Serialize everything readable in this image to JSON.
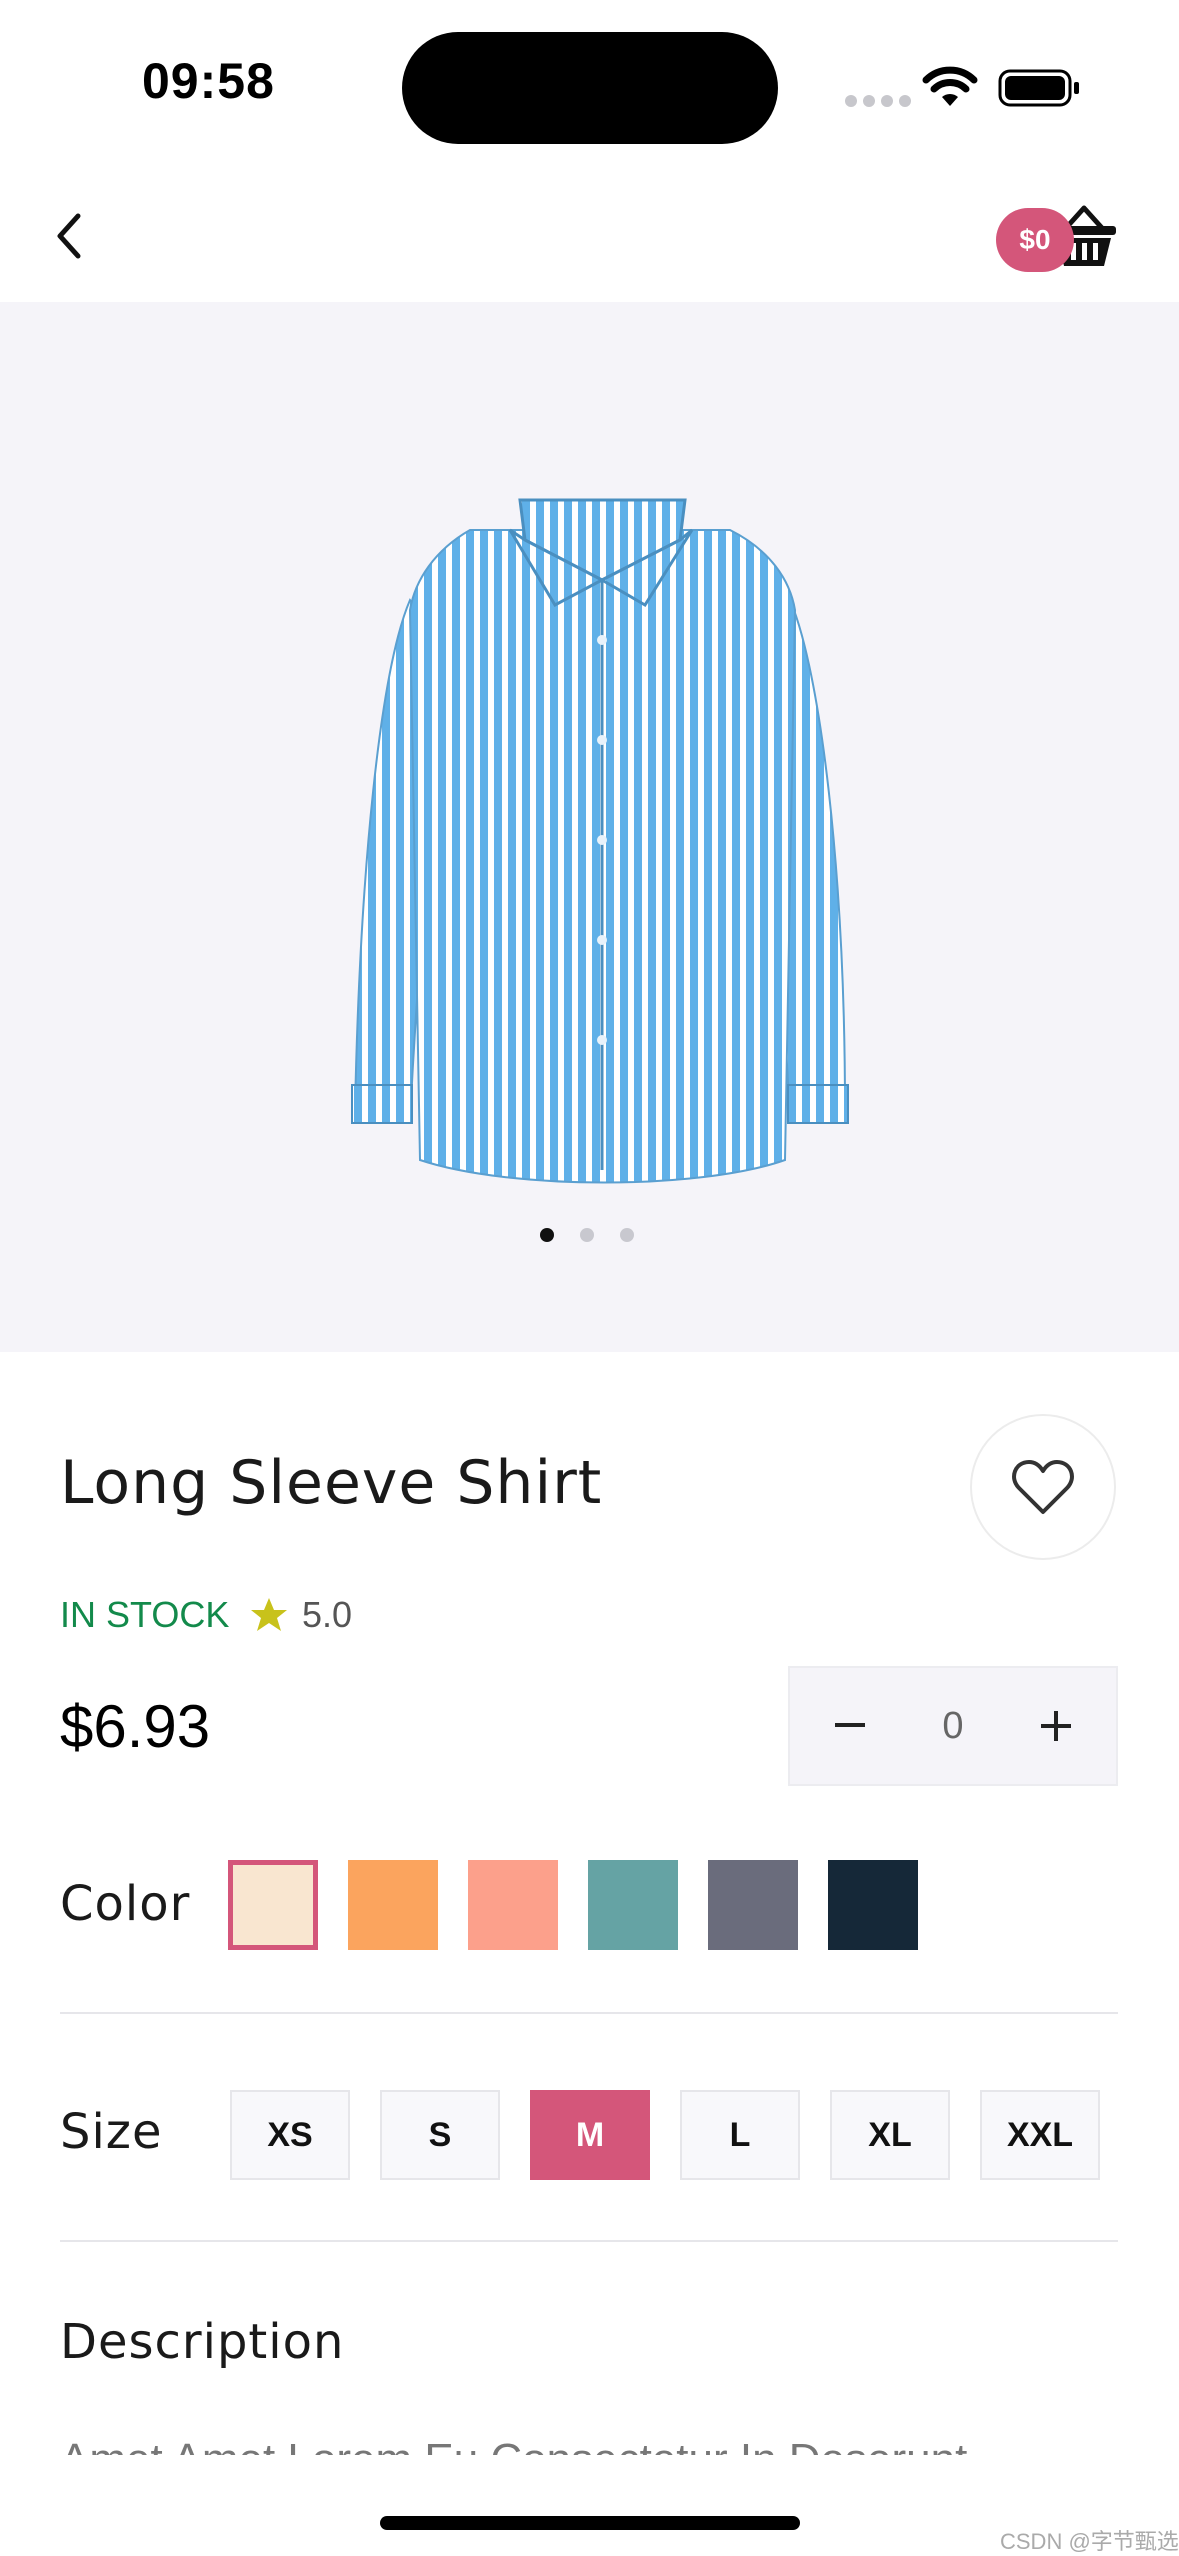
{
  "status_bar": {
    "time": "09:58"
  },
  "header": {
    "cart_amount": "$0",
    "icons": {
      "back": "chevron-left-icon",
      "cart": "basket-icon"
    }
  },
  "gallery": {
    "image": "striped-shirt",
    "dot_count": 3,
    "active_index": 0
  },
  "product": {
    "name": "Long Sleeve Shirt",
    "stock": "IN STOCK",
    "rating": "5.0",
    "price": "$6.93",
    "quantity": "0",
    "favorite_icon": "heart-outline-icon"
  },
  "color": {
    "label": "Color",
    "options": [
      "#f9e6d0",
      "#fba45e",
      "#fca08b",
      "#65a3a4",
      "#6a6c7c",
      "#152838"
    ],
    "selected_index": 0
  },
  "size": {
    "label": "Size",
    "options": [
      "XS",
      "S",
      "M",
      "L",
      "XL",
      "XXL"
    ],
    "selected": "M"
  },
  "description": {
    "label": "Description",
    "text": "Amet Amet Lorem Eu Consectetur In Deserunt"
  },
  "accent_color": "#d4567a",
  "watermark": "CSDN @字节甄选"
}
